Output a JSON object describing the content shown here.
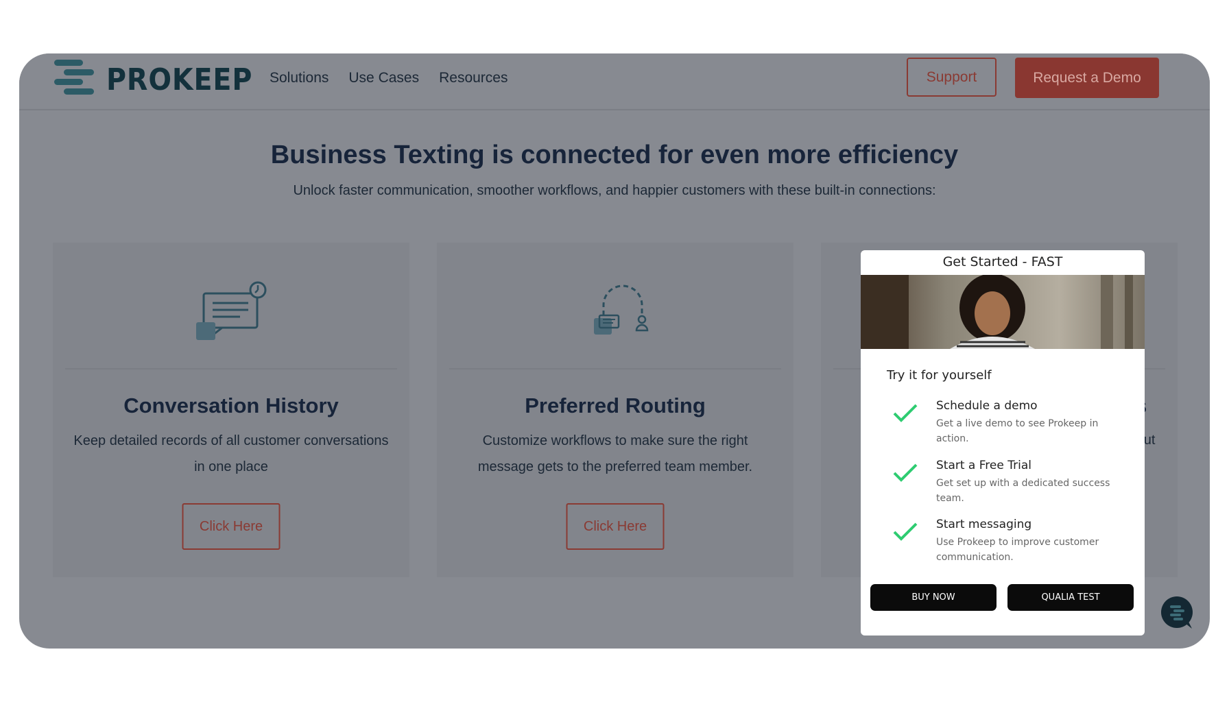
{
  "header": {
    "logo_text": "PROKEEP",
    "nav": [
      "Solutions",
      "Use Cases",
      "Resources"
    ],
    "support_label": "Support",
    "demo_label": "Request a Demo"
  },
  "hero": {
    "headline": "Business Texting is connected for even more efficiency",
    "subline": "Unlock faster communication, smoother workflows, and happier customers with these built-in connections:"
  },
  "cards": [
    {
      "title": "Conversation History",
      "desc_line1": "Keep detailed records of all customer conversations",
      "desc_line2": "in one place",
      "button": "Click Here",
      "icon": "chat-history-icon"
    },
    {
      "title": "Preferred Routing",
      "desc_line1": "Customize workflows to make sure the right",
      "desc_line2": "message gets to the preferred team member.",
      "button": "Click Here",
      "icon": "routing-icon"
    },
    {
      "peek_title": "s",
      "peek_desc": "thout"
    }
  ],
  "popup": {
    "title": "Get Started - FAST",
    "subtitle": "Try it for yourself",
    "options": [
      {
        "title": "Schedule a demo",
        "desc": "Get a live demo to see Prokeep in action."
      },
      {
        "title": "Start a Free Trial",
        "desc": "Get set up with a dedicated success team."
      },
      {
        "title": "Start messaging",
        "desc": "Use Prokeep to improve customer communication."
      }
    ],
    "buy_label": "BUY NOW",
    "test_label": "QUALIA TEST"
  },
  "colors": {
    "overlay": "#878a91",
    "brand_red": "#8a3731",
    "navy": "#17243a",
    "check_green": "#2ecc71"
  }
}
